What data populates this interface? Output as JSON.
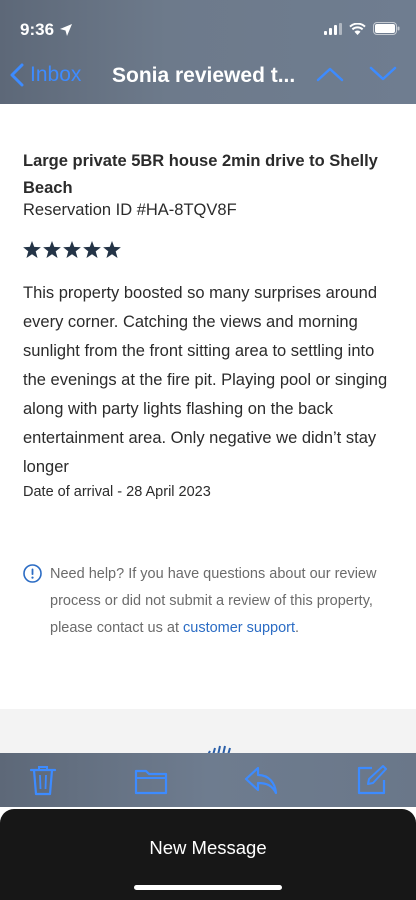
{
  "status_bar": {
    "time": "9:36"
  },
  "nav": {
    "back_label": "Inbox",
    "title": "Sonia reviewed t..."
  },
  "email": {
    "property_title": "Large private 5BR house 2min drive to Shelly Beach",
    "reservation_id": "Reservation ID #HA-8TQV8F",
    "rating": {
      "stars": 5,
      "max": 5
    },
    "review_text": "This property boosted so many surprises around every corner. Catching the views and morning sunlight from the front sitting area to settling into the evenings at the fire pit. Playing pool or singing along with party lights flashing on the back entertainment area. Only negative we didn’t stay longer",
    "arrival": "Date of arrival - 28 April 2023",
    "help": {
      "text": "Need help? If you have questions about our review process or did not submit a review of this property, please contact us at ",
      "link": "customer support",
      "suffix": "."
    }
  },
  "toolbar": {
    "icons": [
      "trash-icon",
      "folder-icon",
      "reply-icon",
      "compose-icon"
    ]
  },
  "sheet": {
    "title": "New Message"
  },
  "colors": {
    "accent": "#3d8bff",
    "link": "#2b6cc4",
    "star": "#243447",
    "bar": "#6b788a"
  }
}
